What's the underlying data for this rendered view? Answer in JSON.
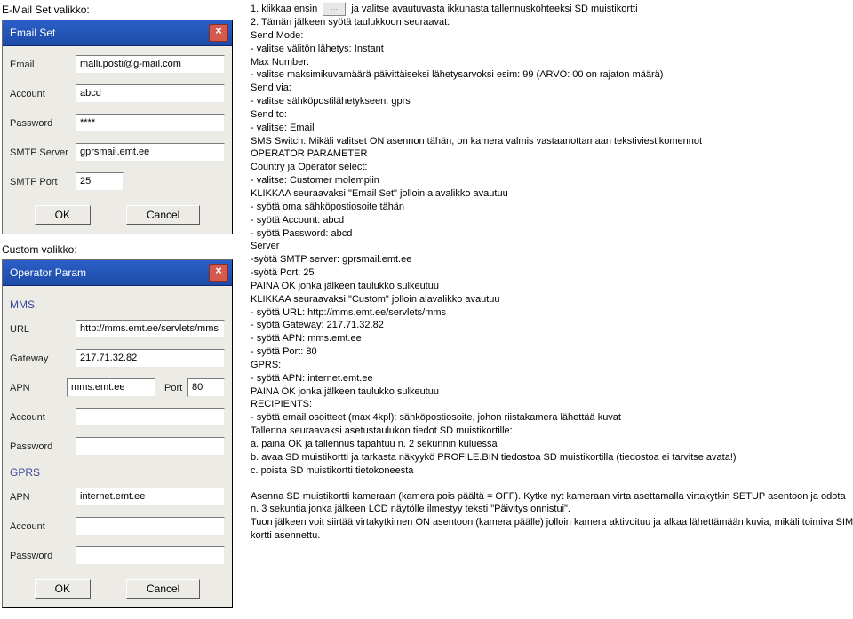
{
  "left": {
    "caption1": "E-Mail Set valikko:",
    "caption2": "Custom valikko:",
    "emailSet": {
      "title": "Email Set",
      "fields": [
        {
          "label": "Email",
          "value": "malli.posti@g-mail.com"
        },
        {
          "label": "Account",
          "value": "abcd"
        },
        {
          "label": "Password",
          "value": "****"
        },
        {
          "label": "SMTP Server",
          "value": "gprsmail.emt.ee"
        },
        {
          "label": "SMTP Port",
          "value": "25"
        }
      ],
      "ok": "OK",
      "cancel": "Cancel"
    },
    "operator": {
      "title": "Operator Param",
      "mms_head": "MMS",
      "gprs_head": "GPRS",
      "mms_fields": {
        "url": {
          "label": "URL",
          "value": "http://mms.emt.ee/servlets/mms"
        },
        "gateway": {
          "label": "Gateway",
          "value": "217.71.32.82"
        },
        "apn": {
          "label": "APN",
          "value": "mms.emt.ee"
        },
        "port_label": "Port",
        "port_value": "80",
        "account": {
          "label": "Account",
          "value": ""
        },
        "password": {
          "label": "Password",
          "value": ""
        }
      },
      "gprs_fields": {
        "apn": {
          "label": "APN",
          "value": "internet.emt.ee"
        },
        "account": {
          "label": "Account",
          "value": ""
        },
        "password": {
          "label": "Password",
          "value": ""
        }
      },
      "ok": "OK",
      "cancel": "Cancel"
    }
  },
  "right": {
    "line_1a": "1.   klikkaa ensin",
    "line_1b": "ja valitse avautuvasta ikkunasta tallennuskohteeksi SD muistikortti",
    "line_2": "2.   Tämän jälkeen syötä taulukkoon seuraavat:",
    "lines_a": [
      "Send Mode:",
      " - valitse välitön lähetys: Instant",
      "Max Number:",
      " - valitse maksimikuvamäärä päivittäiseksi lähetysarvoksi esim: 99 (ARVO: 00 on rajaton määrä)",
      "Send via:",
      " - valitse sähköpostilähetykseen: gprs",
      "Send to:",
      " - valitse: Email",
      "SMS Switch: Mikäli valitset ON asennon tähän, on kamera valmis vastaanottamaan tekstiviestikomennot",
      "OPERATOR PARAMETER",
      "Country ja Operator select:",
      " - valitse: Customer molempiin",
      "KLIKKAA seuraavaksi \"Email Set\" jolloin alavalikko avautuu",
      " - syötä oma sähköpostiosoite tähän",
      " - syötä Account: abcd",
      "  - syötä Password: abcd",
      "Server",
      " -syötä SMTP server:  gprsmail.emt.ee",
      " -syötä Port: 25",
      "PAINA OK jonka jälkeen taulukko sulkeutuu",
      "KLIKKAA seuraavaksi \"Custom\" jolloin alavalikko avautuu",
      " - syötä URL: http://mms.emt.ee/servlets/mms",
      " - syötä Gateway: 217.71.32.82",
      "  - syötä APN: mms.emt.ee",
      " - syötä Port: 80",
      "GPRS:",
      " - syötä APN: internet.emt.ee",
      "PAINA OK jonka jälkeen taulukko sulkeutuu",
      "RECIPIENTS:",
      " - syötä email osoitteet (max 4kpl): sähköpostiosoite, johon riistakamera lähettää kuvat",
      "Tallenna seuraavaksi asetustaulukon tiedot SD muistikortille:",
      "a.                           paina OK  ja tallennus tapahtuu n. 2 sekunnin kuluessa",
      "b.                           avaa SD muistikortti ja tarkasta näkyykö PROFILE.BIN tiedostoa SD muistikortilla (tiedostoa ei tarvitse avata!)",
      "c.                           poista SD muistikortti tietokoneesta"
    ],
    "lines_b": [
      "Asenna SD muistikortti kameraan (kamera pois päältä = OFF). Kytke nyt kameraan virta asettamalla virtakytkin SETUP asentoon ja odota n. 3 sekuntia jonka jälkeen LCD näytölle ilmestyy teksti \"Päivitys onnistui\".",
      "Tuon jälkeen voit siirtää virtakytkimen ON asentoon (kamera päälle) jolloin kamera aktivoituu ja alkaa lähettämään kuvia, mikäli toimiva SIM kortti asennettu."
    ],
    "icon_glyph": "…"
  }
}
